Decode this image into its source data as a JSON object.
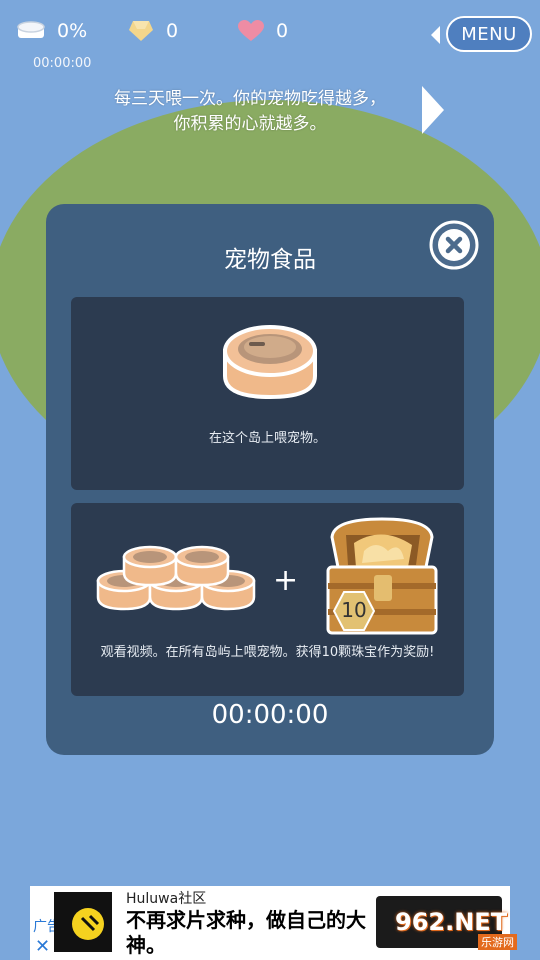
{
  "hud": {
    "progress": "0%",
    "gems": "0",
    "hearts": "0",
    "timer": "00:00:00",
    "menu_label": "MENU"
  },
  "tip": {
    "line1": "每三天喂一次。你的宠物吃得越多，",
    "line2": "你积累的心就越多。"
  },
  "panel": {
    "title": "宠物食品",
    "card1_text": "在这个岛上喂宠物。",
    "card2_text": "观看视频。在所有岛屿上喂宠物。获得10颗珠宝作为奖励!",
    "chest_badge": "10",
    "plus": "+",
    "timer": "00:00:00"
  },
  "ad": {
    "tag": "广告",
    "close": "✕",
    "brand": "Huluwa社区",
    "headline": "不再求片求种，做自己的大神。"
  },
  "watermark": {
    "text": "962.NET",
    "sub": "乐游网"
  },
  "icons": {
    "progress": "tin-can-icon",
    "gems": "gem-icon",
    "hearts": "heart-icon",
    "close": "close-icon",
    "next": "chevron-right-icon"
  },
  "colors": {
    "sky": "#7ba7db",
    "island": "#8aab62",
    "panel": "#3f5f80",
    "card": "#2c3b50",
    "can": "#f0b98a",
    "heart": "#ee8ca4"
  }
}
